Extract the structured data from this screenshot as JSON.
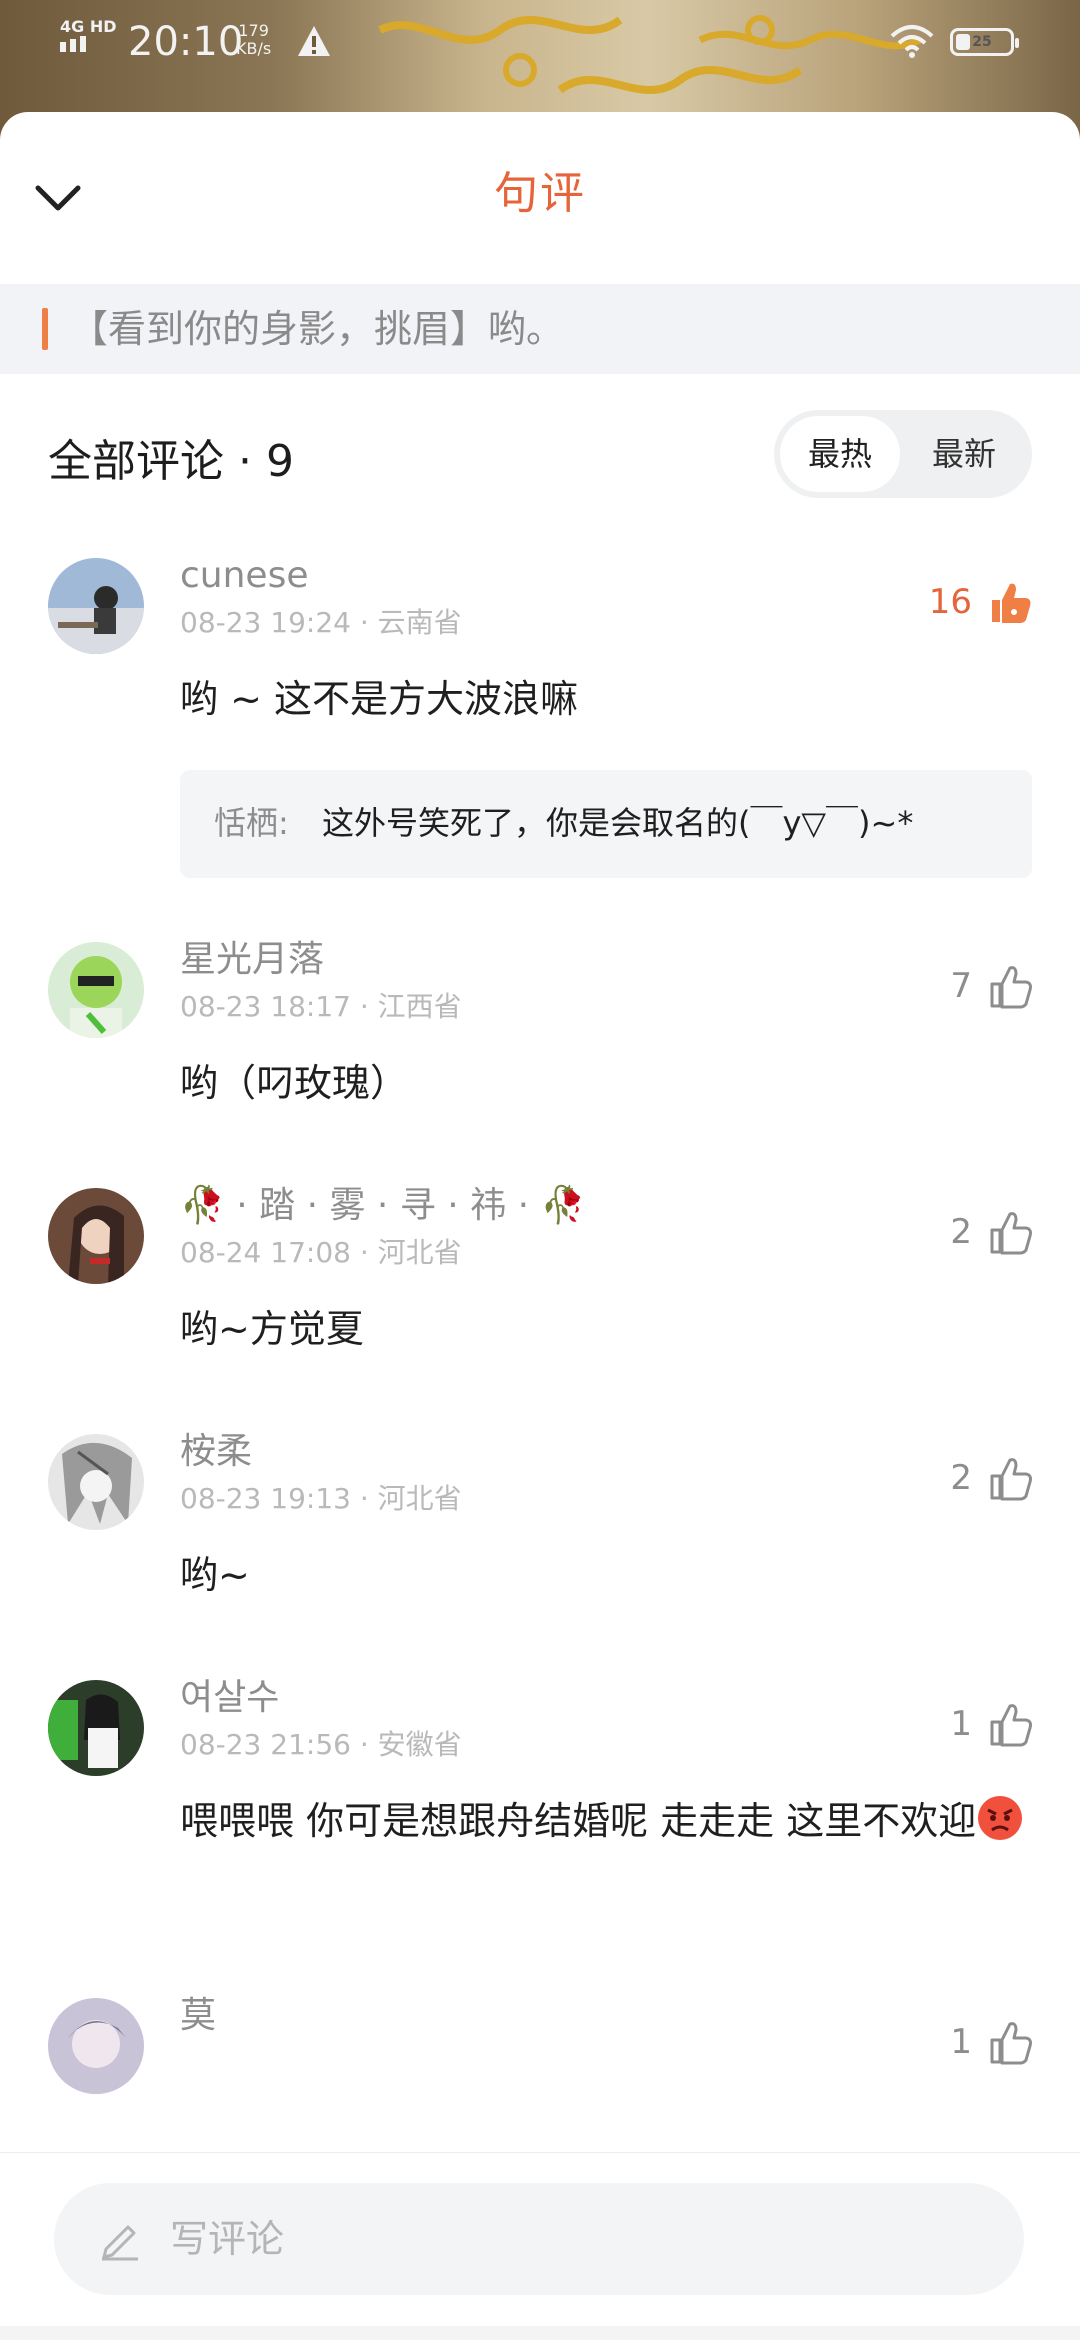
{
  "status_bar": {
    "signal": "4G HD",
    "time": "20:10",
    "speed_value": "179",
    "speed_unit": "KB/s",
    "battery": "25",
    "icons": [
      "signal-icon",
      "warning-icon",
      "wifi-icon",
      "battery-icon"
    ]
  },
  "sheet": {
    "title": "句评",
    "quote": "【看到你的身影，挑眉】哟。",
    "comments_title": "全部评论 · 9",
    "sort": {
      "hot": "最热",
      "new": "最新",
      "selected": "最热"
    }
  },
  "comments": [
    {
      "user": "cunese",
      "time": "08-23 19:24",
      "location": "云南省",
      "text": "哟 ~ 这不是方大波浪嘛",
      "likes": "16",
      "liked": true,
      "reply": {
        "author": "恬栖:",
        "text": "这外号笑死了，你是会取名的(￣y▽￣)~*"
      }
    },
    {
      "user": "星光月落",
      "time": "08-23 18:17",
      "location": "江西省",
      "text": "哟（叼玫瑰）",
      "likes": "7",
      "liked": false
    },
    {
      "user": "🥀 · 踏 · 雾 · 寻 · 祎 · 🥀",
      "time": "08-24 17:08",
      "location": "河北省",
      "text": "哟~方觉夏",
      "likes": "2",
      "liked": false
    },
    {
      "user": "桉柔",
      "time": "08-23 19:13",
      "location": "河北省",
      "text": "哟~",
      "likes": "2",
      "liked": false
    },
    {
      "user": "여살수",
      "time": "08-23 21:56",
      "location": "安徽省",
      "text": "喂喂喂 你可是想跟舟结婚呢 走走走 这里不欢迎",
      "likes": "1",
      "liked": false
    },
    {
      "user": "莫",
      "likes": "1",
      "liked": false
    }
  ],
  "input": {
    "placeholder": "写评论"
  },
  "nav": {
    "icons": [
      "menu-icon",
      "home-icon",
      "back-icon"
    ]
  },
  "colors": {
    "accent": "#e5643a",
    "quote_bar": "#f1f3f6",
    "muted": "#8d8d8d"
  }
}
